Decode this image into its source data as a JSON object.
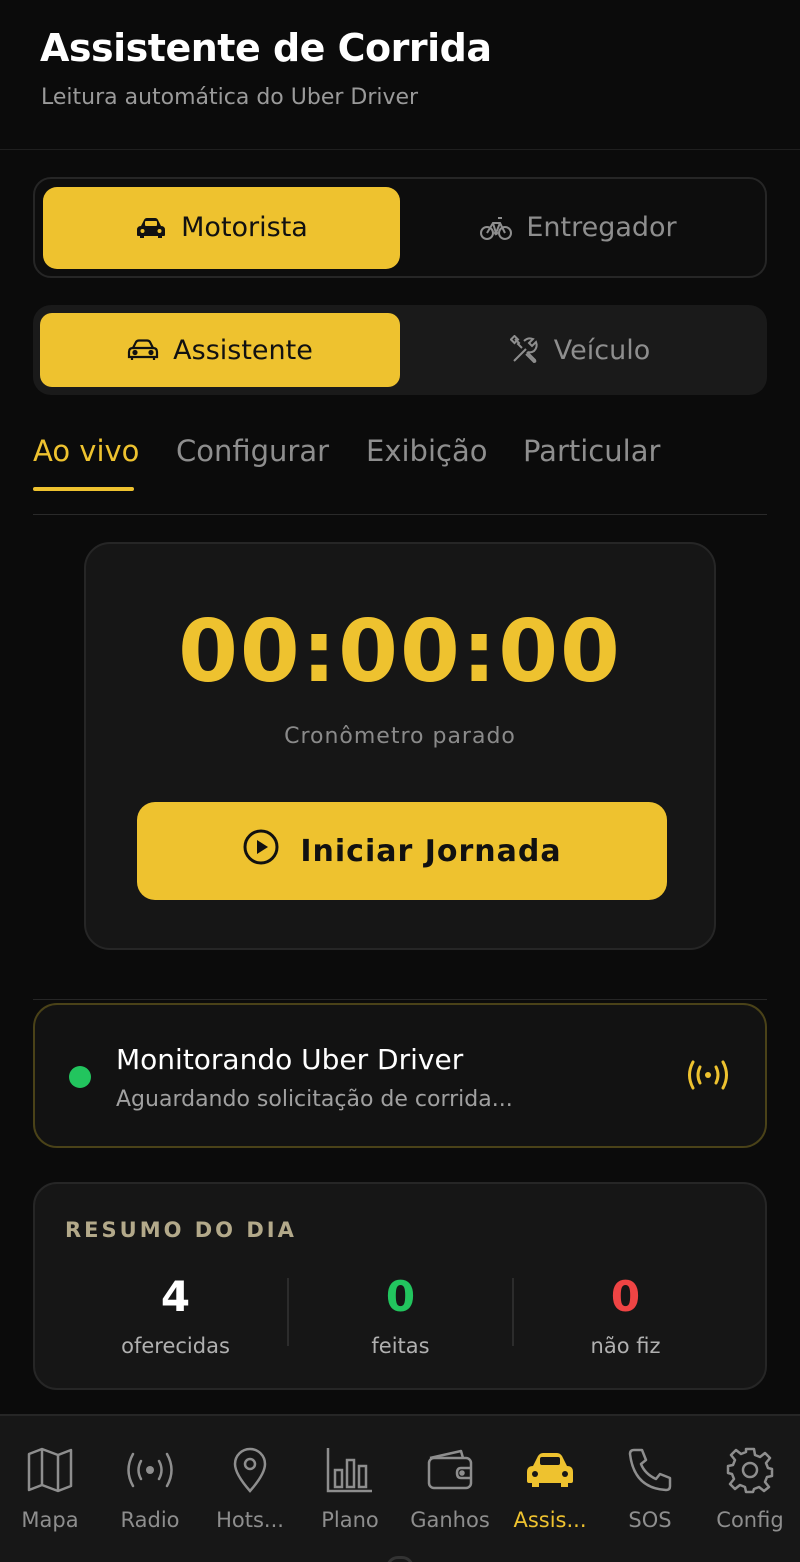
{
  "header": {
    "title": "Assistente de Corrida",
    "subtitle": "Leitura automática do Uber Driver"
  },
  "mode_selector": {
    "options": [
      {
        "label": "Motorista",
        "icon": "car-icon",
        "active": true
      },
      {
        "label": "Entregador",
        "icon": "bicycle-icon",
        "active": false
      }
    ]
  },
  "section_selector": {
    "options": [
      {
        "label": "Assistente",
        "icon": "car-outline-icon",
        "active": true
      },
      {
        "label": "Veículo",
        "icon": "tools-icon",
        "active": false
      }
    ]
  },
  "tabs": [
    {
      "label": "Ao vivo",
      "active": true
    },
    {
      "label": "Configurar",
      "active": false
    },
    {
      "label": "Exibição",
      "active": false
    },
    {
      "label": "Particular",
      "active": false
    }
  ],
  "timer": {
    "value": "00:00:00",
    "status": "Cronômetro parado",
    "button_label": "Iniciar Jornada",
    "button_icon": "play-circle-icon"
  },
  "monitor": {
    "title": "Monitorando Uber Driver",
    "subtitle": "Aguardando solicitação de corrida...",
    "status_color": "#22c55e",
    "icon": "broadcast-icon"
  },
  "summary": {
    "title": "RESUMO DO DIA",
    "stats": [
      {
        "value": "4",
        "label": "oferecidas",
        "color": "#ffffff"
      },
      {
        "value": "0",
        "label": "feitas",
        "color": "#22c55e"
      },
      {
        "value": "0",
        "label": "não fiz",
        "color": "#ef4444"
      }
    ]
  },
  "bottom_nav": {
    "items": [
      {
        "label": "Mapa",
        "icon": "map-icon",
        "active": false
      },
      {
        "label": "Radio",
        "icon": "radio-icon",
        "active": false
      },
      {
        "label": "Hots...",
        "icon": "location-pin-icon",
        "active": false
      },
      {
        "label": "Plano",
        "icon": "bar-chart-icon",
        "active": false
      },
      {
        "label": "Ganhos",
        "icon": "wallet-icon",
        "active": false
      },
      {
        "label": "Assis...",
        "icon": "car-icon",
        "active": true
      },
      {
        "label": "SOS",
        "icon": "phone-icon",
        "active": false
      },
      {
        "label": "Config",
        "icon": "gear-icon",
        "active": false
      }
    ]
  },
  "colors": {
    "accent": "#eec22f",
    "background": "#0b0b0b",
    "card": "#161616"
  }
}
